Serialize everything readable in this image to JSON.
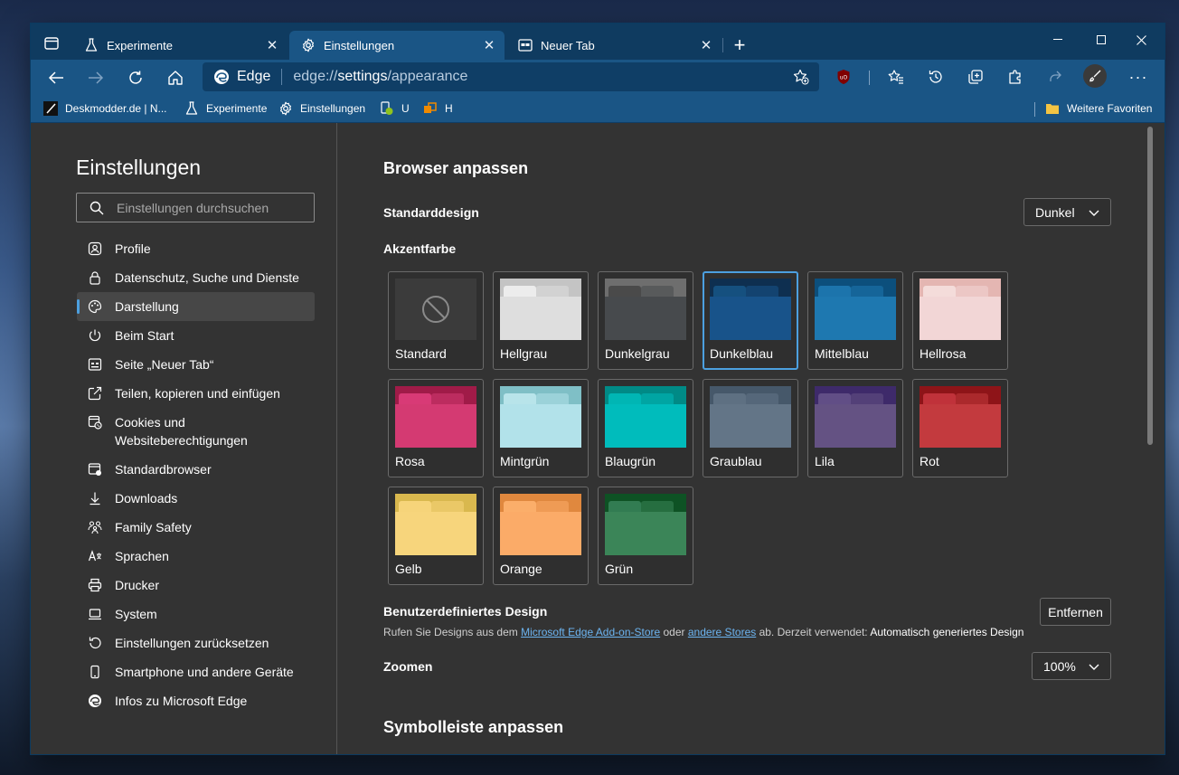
{
  "tabs": [
    {
      "label": "Experimente",
      "icon": "flask-icon"
    },
    {
      "label": "Einstellungen",
      "icon": "gear-icon",
      "active": true
    },
    {
      "label": "Neuer Tab",
      "icon": "newtab-page-icon"
    }
  ],
  "address": {
    "brand": "Edge",
    "url_prefix": "edge://",
    "url_host": "settings",
    "url_path": "/appearance"
  },
  "favorites": [
    {
      "label": "Deskmodder.de | N...",
      "icon": "deskmodder-icon"
    },
    {
      "label": "Experimente",
      "icon": "flask-icon"
    },
    {
      "label": "Einstellungen",
      "icon": "gear-icon"
    },
    {
      "label": "U",
      "icon": "u-bookmark-icon"
    },
    {
      "label": "H",
      "icon": "h-bookmark-icon"
    }
  ],
  "favorites_other": "Weitere Favoriten",
  "sidebar": {
    "title": "Einstellungen",
    "search_placeholder": "Einstellungen durchsuchen",
    "items": [
      {
        "label": "Profile",
        "icon": "profile-icon"
      },
      {
        "label": "Datenschutz, Suche und Dienste",
        "icon": "lock-icon"
      },
      {
        "label": "Darstellung",
        "icon": "palette-icon",
        "active": true
      },
      {
        "label": "Beim Start",
        "icon": "power-icon"
      },
      {
        "label": "Seite „Neuer Tab“",
        "icon": "newtab-page-icon"
      },
      {
        "label": "Teilen, kopieren und einfügen",
        "icon": "share-icon"
      },
      {
        "label": "Cookies und Websiteberechtigungen",
        "icon": "cookie-icon"
      },
      {
        "label": "Standardbrowser",
        "icon": "browser-icon"
      },
      {
        "label": "Downloads",
        "icon": "download-icon"
      },
      {
        "label": "Family Safety",
        "icon": "family-icon"
      },
      {
        "label": "Sprachen",
        "icon": "language-icon"
      },
      {
        "label": "Drucker",
        "icon": "printer-icon"
      },
      {
        "label": "System",
        "icon": "laptop-icon"
      },
      {
        "label": "Einstellungen zurücksetzen",
        "icon": "reset-icon"
      },
      {
        "label": "Smartphone und andere Geräte",
        "icon": "phone-icon"
      },
      {
        "label": "Infos zu Microsoft Edge",
        "icon": "edge-icon"
      }
    ]
  },
  "main": {
    "section_title": "Browser anpassen",
    "default_design_label": "Standarddesign",
    "default_design_value": "Dunkel",
    "accent_label": "Akzentfarbe",
    "swatches": [
      {
        "label": "Standard",
        "bg": "#3b3b3b",
        "tab": "#3b3b3b",
        "body": "#3b3b3b",
        "default": true
      },
      {
        "label": "Hellgrau",
        "bg": "#c4c4c4",
        "tab": "#ececec",
        "body": "#dedede"
      },
      {
        "label": "Dunkelgrau",
        "bg": "#6e6e6e",
        "tab": "#4a4a4a",
        "body": "#474a4d"
      },
      {
        "label": "Dunkelblau",
        "bg": "#0e2f50",
        "tab": "#15507f",
        "body": "#18538a",
        "selected": true
      },
      {
        "label": "Mittelblau",
        "bg": "#0c4f7c",
        "tab": "#1c74ac",
        "body": "#1e78b0"
      },
      {
        "label": "Hellrosa",
        "bg": "#e4b6b2",
        "tab": "#f4dcda",
        "body": "#f2d6d6"
      },
      {
        "label": "Rosa",
        "bg": "#a01b48",
        "tab": "#d83a76",
        "body": "#d43a72"
      },
      {
        "label": "Mintgrün",
        "bg": "#7fbfc6",
        "tab": "#b8e4ea",
        "body": "#b2e2ea"
      },
      {
        "label": "Blaugrün",
        "bg": "#008a86",
        "tab": "#00b6b4",
        "body": "#00bcbc"
      },
      {
        "label": "Graublau",
        "bg": "#46586a",
        "tab": "#5e7082",
        "body": "#637587"
      },
      {
        "label": "Lila",
        "bg": "#3e2a6a",
        "tab": "#614e86",
        "body": "#645283"
      },
      {
        "label": "Rot",
        "bg": "#8e1418",
        "tab": "#c0323a",
        "body": "#c33a3e"
      },
      {
        "label": "Gelb",
        "bg": "#d9b84e",
        "tab": "#f6d47a",
        "body": "#f7d57c"
      },
      {
        "label": "Orange",
        "bg": "#e0883e",
        "tab": "#fbae6a",
        "body": "#fbab68"
      },
      {
        "label": "Grün",
        "bg": "#0e5224",
        "tab": "#327c52",
        "body": "#3b8558"
      }
    ],
    "custom_design_label": "Benutzerdefiniertes Design",
    "custom_design_button": "Entfernen",
    "custom_desc_1": "Rufen Sie Designs aus dem ",
    "custom_desc_link1": "Microsoft Edge Add-on-Store",
    "custom_desc_2": " oder ",
    "custom_desc_link2": "andere Stores",
    "custom_desc_3": " ab. Derzeit verwendet: ",
    "custom_desc_current": "Automatisch generiertes Design",
    "zoom_label": "Zoomen",
    "zoom_value": "100%",
    "toolbar_section_title": "Symbolleiste anpassen"
  },
  "colors": {
    "accent": "#4ca0e0",
    "titlebar": "#0f3b60",
    "toolbar": "#1a5585",
    "content_bg": "#333333"
  }
}
